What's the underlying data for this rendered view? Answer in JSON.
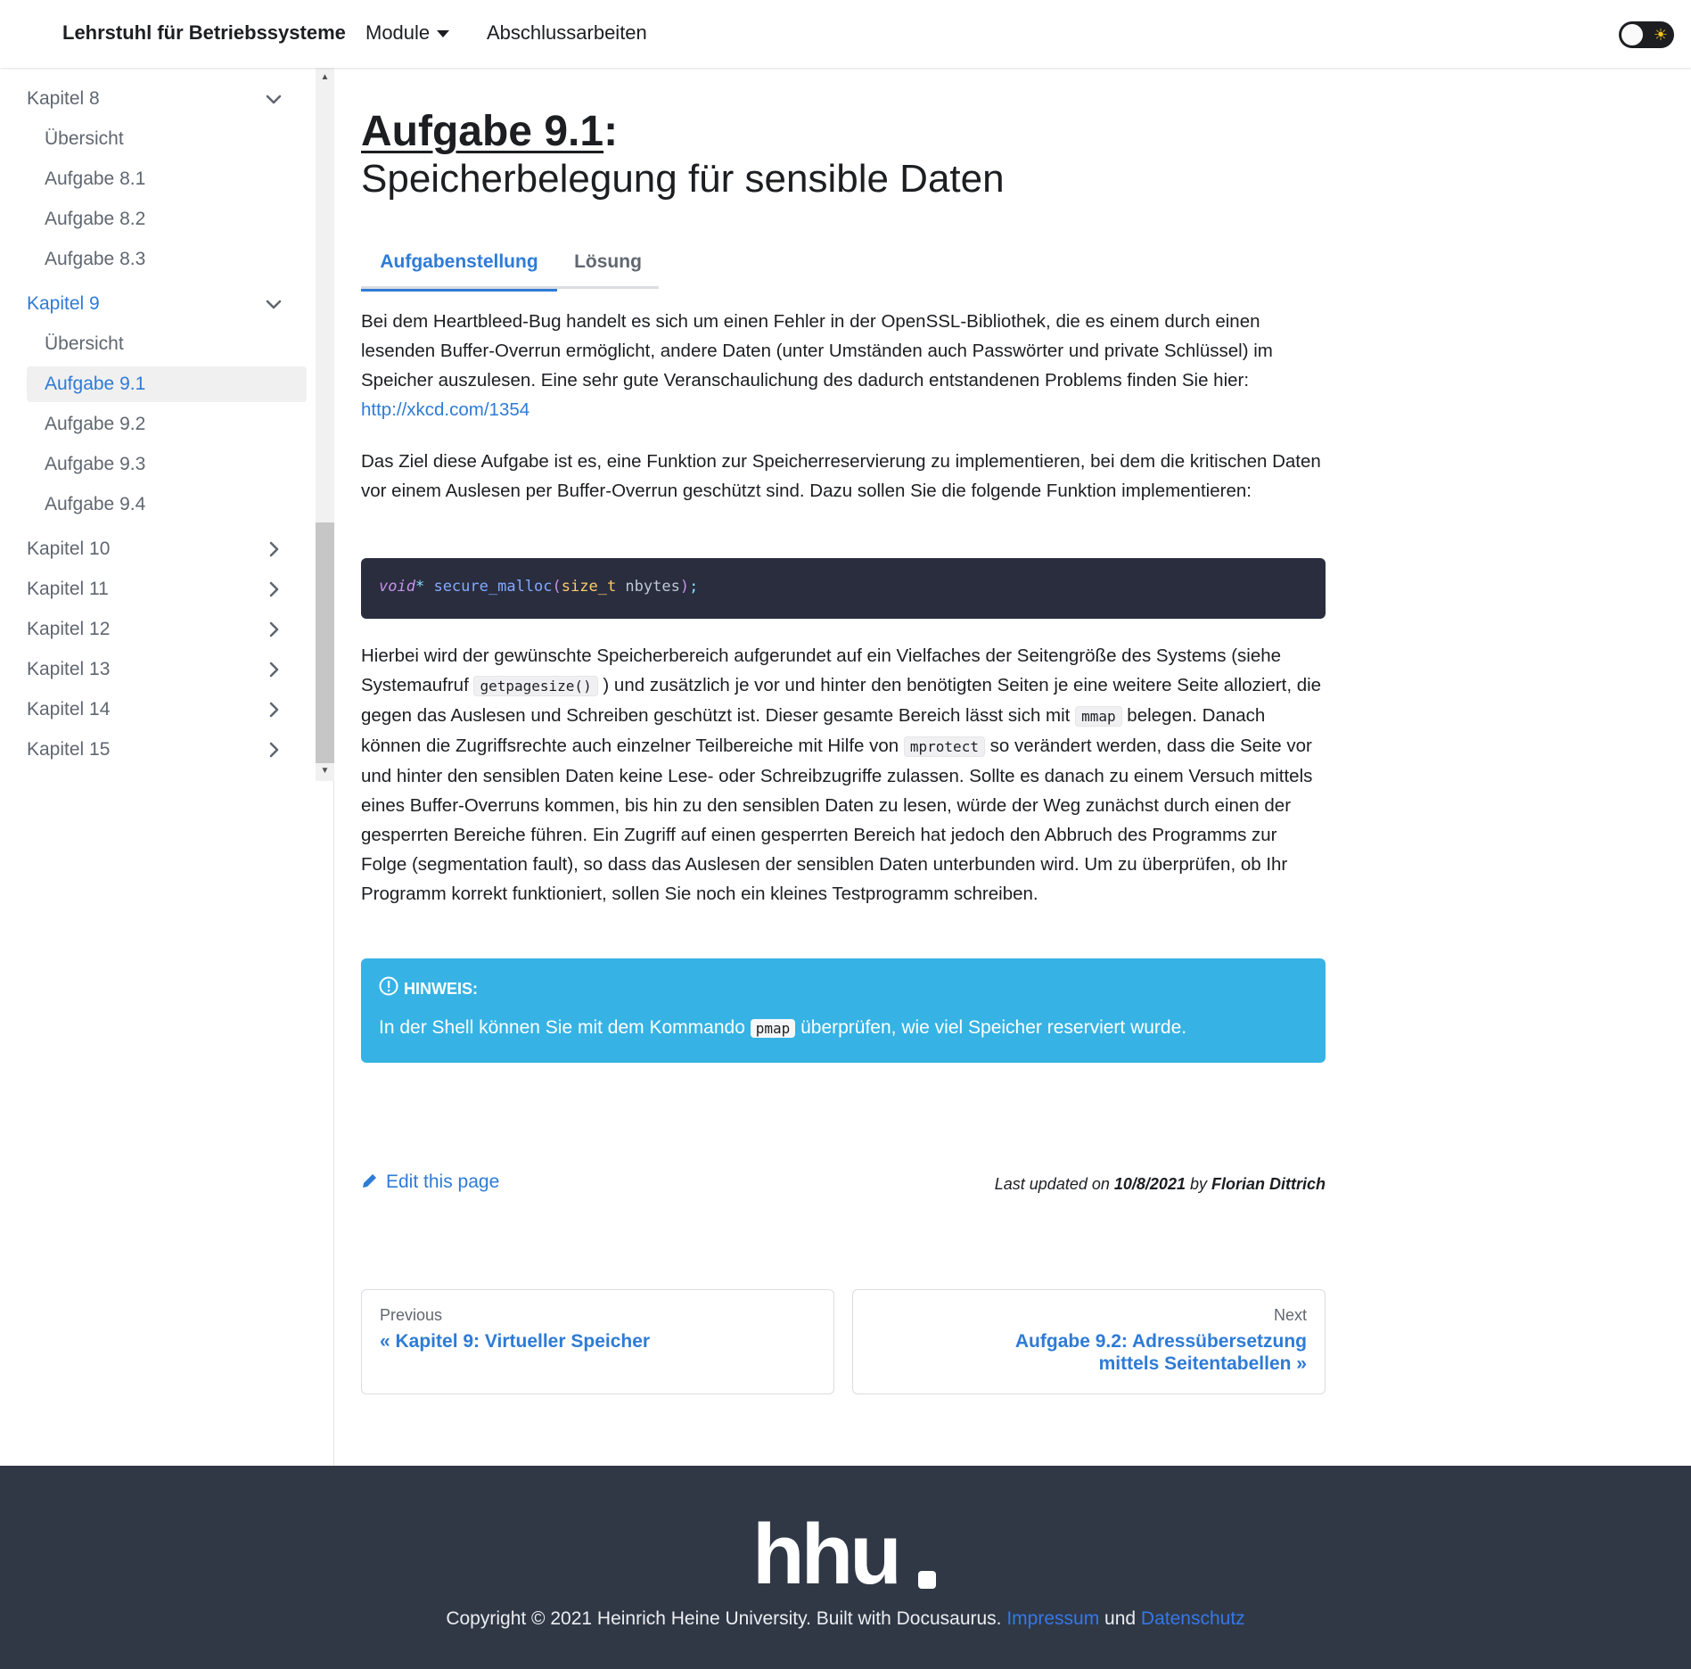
{
  "navbar": {
    "brand": "Lehrstuhl für Betriebssysteme",
    "module": "Module",
    "abschluss": "Abschlussarbeiten"
  },
  "sidebar": {
    "items": [
      {
        "label": "Kapitel 8",
        "level": "top",
        "chevron": "chevron-down"
      },
      {
        "label": "Übersicht",
        "level": "sub"
      },
      {
        "label": "Aufgabe 8.1",
        "level": "sub"
      },
      {
        "label": "Aufgabe 8.2",
        "level": "sub"
      },
      {
        "label": "Aufgabe 8.3",
        "level": "sub"
      },
      {
        "label": "Kapitel 9",
        "level": "top",
        "chevron": "chevron-down"
      },
      {
        "label": "Übersicht",
        "level": "sub"
      },
      {
        "label": "Aufgabe 9.1",
        "level": "sub"
      },
      {
        "label": "Aufgabe 9.2",
        "level": "sub"
      },
      {
        "label": "Aufgabe 9.3",
        "level": "sub"
      },
      {
        "label": "Aufgabe 9.4",
        "level": "sub"
      },
      {
        "label": "Kapitel 10",
        "level": "top",
        "chevron": "chevron-right"
      },
      {
        "label": "Kapitel 11",
        "level": "top",
        "chevron": "chevron-right"
      },
      {
        "label": "Kapitel 12",
        "level": "top",
        "chevron": "chevron-right"
      },
      {
        "label": "Kapitel 13",
        "level": "top",
        "chevron": "chevron-right"
      },
      {
        "label": "Kapitel 14",
        "level": "top",
        "chevron": "chevron-right"
      },
      {
        "label": "Kapitel 15",
        "level": "top",
        "chevron": "chevron-right"
      }
    ]
  },
  "main": {
    "title_number": "Aufgabe 9.1",
    "title_colon": ":",
    "subtitle": "Speicherbelegung für sensible Daten",
    "tabs": [
      {
        "label": "Aufgabenstellung",
        "active": true
      },
      {
        "label": "Lösung",
        "active": false
      }
    ],
    "p1_text": "Bei dem Heartbleed-Bug handelt es sich um einen Fehler in der OpenSSL-Bibliothek, die es einem durch einen lesenden Buffer-Overrun ermöglicht, andere Daten (unter Umständen auch Passwörter und private Schlüssel) im Speicher auszulesen. Eine sehr gute Veranschaulichung des dadurch entstandenen Problems finden Sie hier:",
    "p1_link": "http://xkcd.com/1354",
    "p2_text": "Das Ziel diese Aufgabe ist es, eine Funktion zur Speicherreservierung zu implementieren, bei dem die kritischen Daten vor einem Auslesen per Buffer-Overrun geschützt sind. Dazu sollen Sie die folgende Funktion implementieren:",
    "code": {
      "void": "void",
      "star": "*",
      "fn": "secure_malloc",
      "open": "(",
      "type": "size_t",
      "arg": " nbytes",
      "close": ")",
      "semi": ";"
    },
    "p3": {
      "a": "Hierbei wird der gewünschte Speicherbereich aufgerundet auf ein Vielfaches der Seitengröße des Systems (siehe Systemaufruf ",
      "code1": "getpagesize()",
      "b": " ) und zusätzlich je vor und hinter den benötigten Seiten je eine weitere Seite alloziert, die gegen das Auslesen und Schreiben geschützt ist. Dieser gesamte Bereich lässt sich mit ",
      "code2": "mmap",
      "c": " belegen. Danach können die Zugriffsrechte auch einzelner Teilbereiche mit Hilfe von ",
      "code3": "mprotect",
      "d": " so verändert werden, dass die Seite vor und hinter den sensiblen Daten keine Lese- oder Schreibzugriffe zulassen. Sollte es danach zu einem Versuch mittels eines Buffer-Overruns kommen, bis hin zu den sensiblen Daten zu lesen, würde der Weg zunächst durch einen der gesperrten Bereiche führen. Ein Zugriff auf einen gesperrten Bereich hat jedoch den Abbruch des Programms zur Folge (segmentation fault), so dass das Auslesen der sensiblen Daten unterbunden wird. Um zu überprüfen, ob Ihr Programm korrekt funktioniert, sollen Sie noch ein kleines Testprogramm schreiben."
    },
    "hint": {
      "title": "HINWEIS:",
      "a": "In der Shell können Sie mit dem Kommando ",
      "code": "pmap",
      "b": " überprüfen, wie viel Speicher reserviert wurde."
    },
    "edit": "Edit this page",
    "updated": {
      "prefix": "Last updated on ",
      "date": "10/8/2021",
      "by": " by ",
      "author": "Florian Dittrich"
    },
    "pager": {
      "prev_sub": "Previous",
      "prev_title": "« Kapitel 9: Virtueller Speicher",
      "next_sub": "Next",
      "next_title": "Aufgabe 9.2: Adressübersetzung mittels Seitentabellen »"
    }
  },
  "footer": {
    "logo_text": "hhu.",
    "copyright": "Copyright © 2021 Heinrich Heine University. Built with Docusaurus. ",
    "impressum": "Impressum",
    "und": " und ",
    "datenschutz": "Datenschutz"
  },
  "colors": {
    "accent": "#2e7bd6",
    "hint_bg": "#36b3e4",
    "footer_bg": "#303846",
    "code_bg": "#292d3e"
  }
}
